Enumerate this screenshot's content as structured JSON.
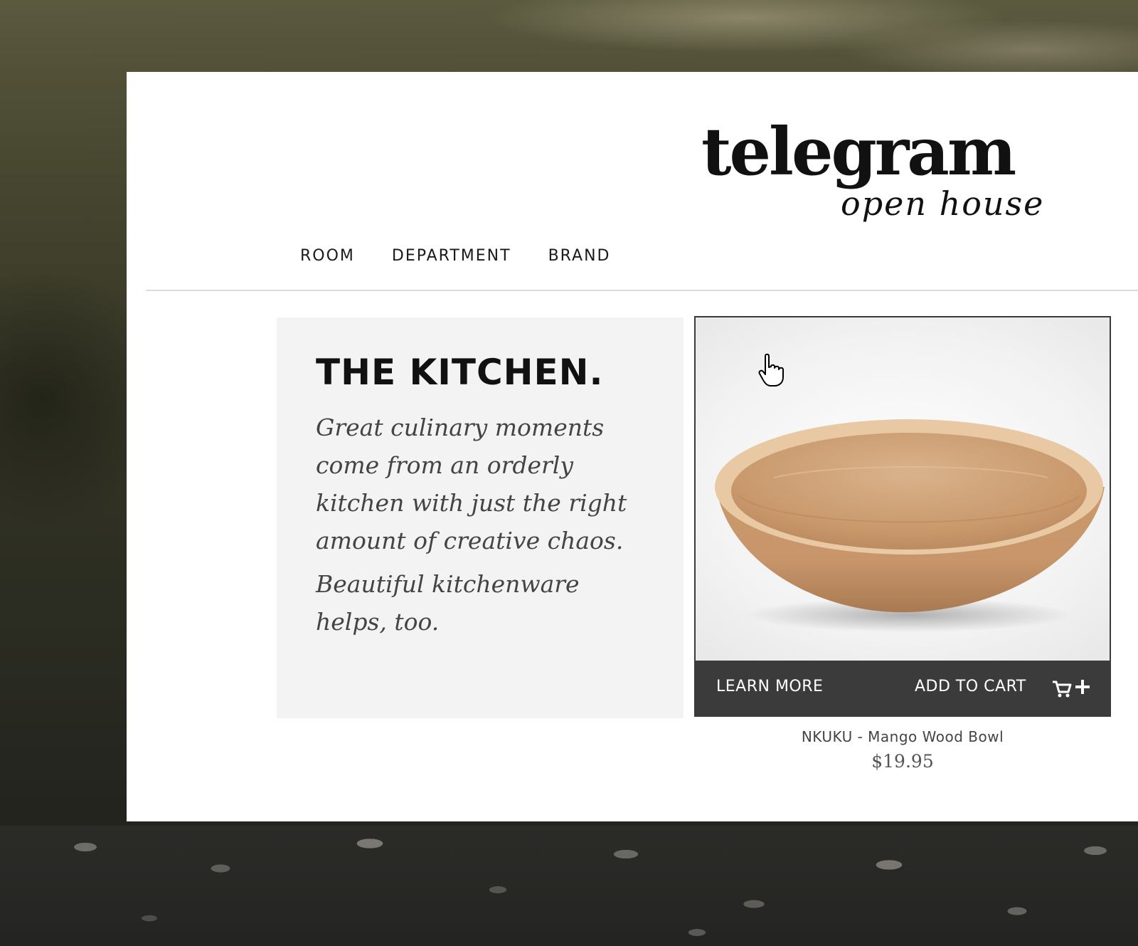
{
  "brand": {
    "name": "telegram",
    "tagline": "open house"
  },
  "nav": {
    "items": [
      "ROOM",
      "DEPARTMENT",
      "BRAND"
    ]
  },
  "intro": {
    "title": "THE KITCHEN.",
    "paragraphs": [
      "Great culinary moments come from an orderly kitchen with just the right amount of creative chaos.",
      "Beautiful kitchenware helps, too."
    ]
  },
  "product": {
    "name": "NKUKU - Mango Wood Bowl",
    "price": "$19.95",
    "learn_more_label": "LEARN MORE",
    "add_to_cart_label": "ADD TO CART",
    "image_icon": "wooden-bowl",
    "cart_icon": "cart-plus-icon"
  },
  "colors": {
    "action_bar": "#3b3b3b",
    "intro_bg": "#f3f3f3",
    "text_dark": "#111111"
  }
}
